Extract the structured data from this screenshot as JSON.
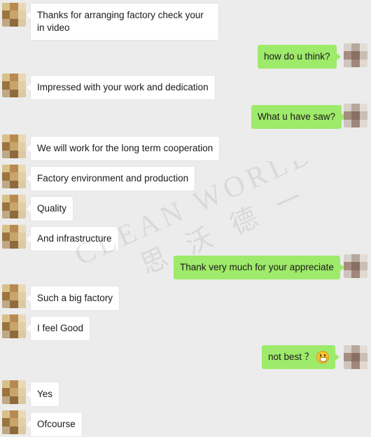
{
  "messages": [
    {
      "side": "left",
      "text": "Thanks for arranging factory check your in video"
    },
    {
      "side": "right",
      "text": "how do u think?"
    },
    {
      "side": "left",
      "text": "Impressed with your work and dedication"
    },
    {
      "side": "right",
      "text": "What u have saw?"
    },
    {
      "side": "left",
      "text": "We will work for the long term cooperation"
    },
    {
      "side": "left",
      "text": "Factory environment and production"
    },
    {
      "side": "left",
      "text": "Quality"
    },
    {
      "side": "left",
      "text": "And infrastructure"
    },
    {
      "side": "right",
      "text": "Thank very much for your appreciate"
    },
    {
      "side": "left",
      "text": "Such a big factory"
    },
    {
      "side": "left",
      "text": "I feel Good"
    },
    {
      "side": "right",
      "text": "not best ？",
      "emoji": "grinning-face-emoji"
    },
    {
      "side": "left",
      "text": "Yes"
    },
    {
      "side": "left",
      "text": "Ofcourse"
    }
  ],
  "watermark": {
    "latin": "CLEAN WORLD",
    "cjk": "一 思 沃 德 一"
  },
  "colors": {
    "background": "#ececec",
    "incoming": "#ffffff",
    "outgoing": "#9eea6a"
  }
}
